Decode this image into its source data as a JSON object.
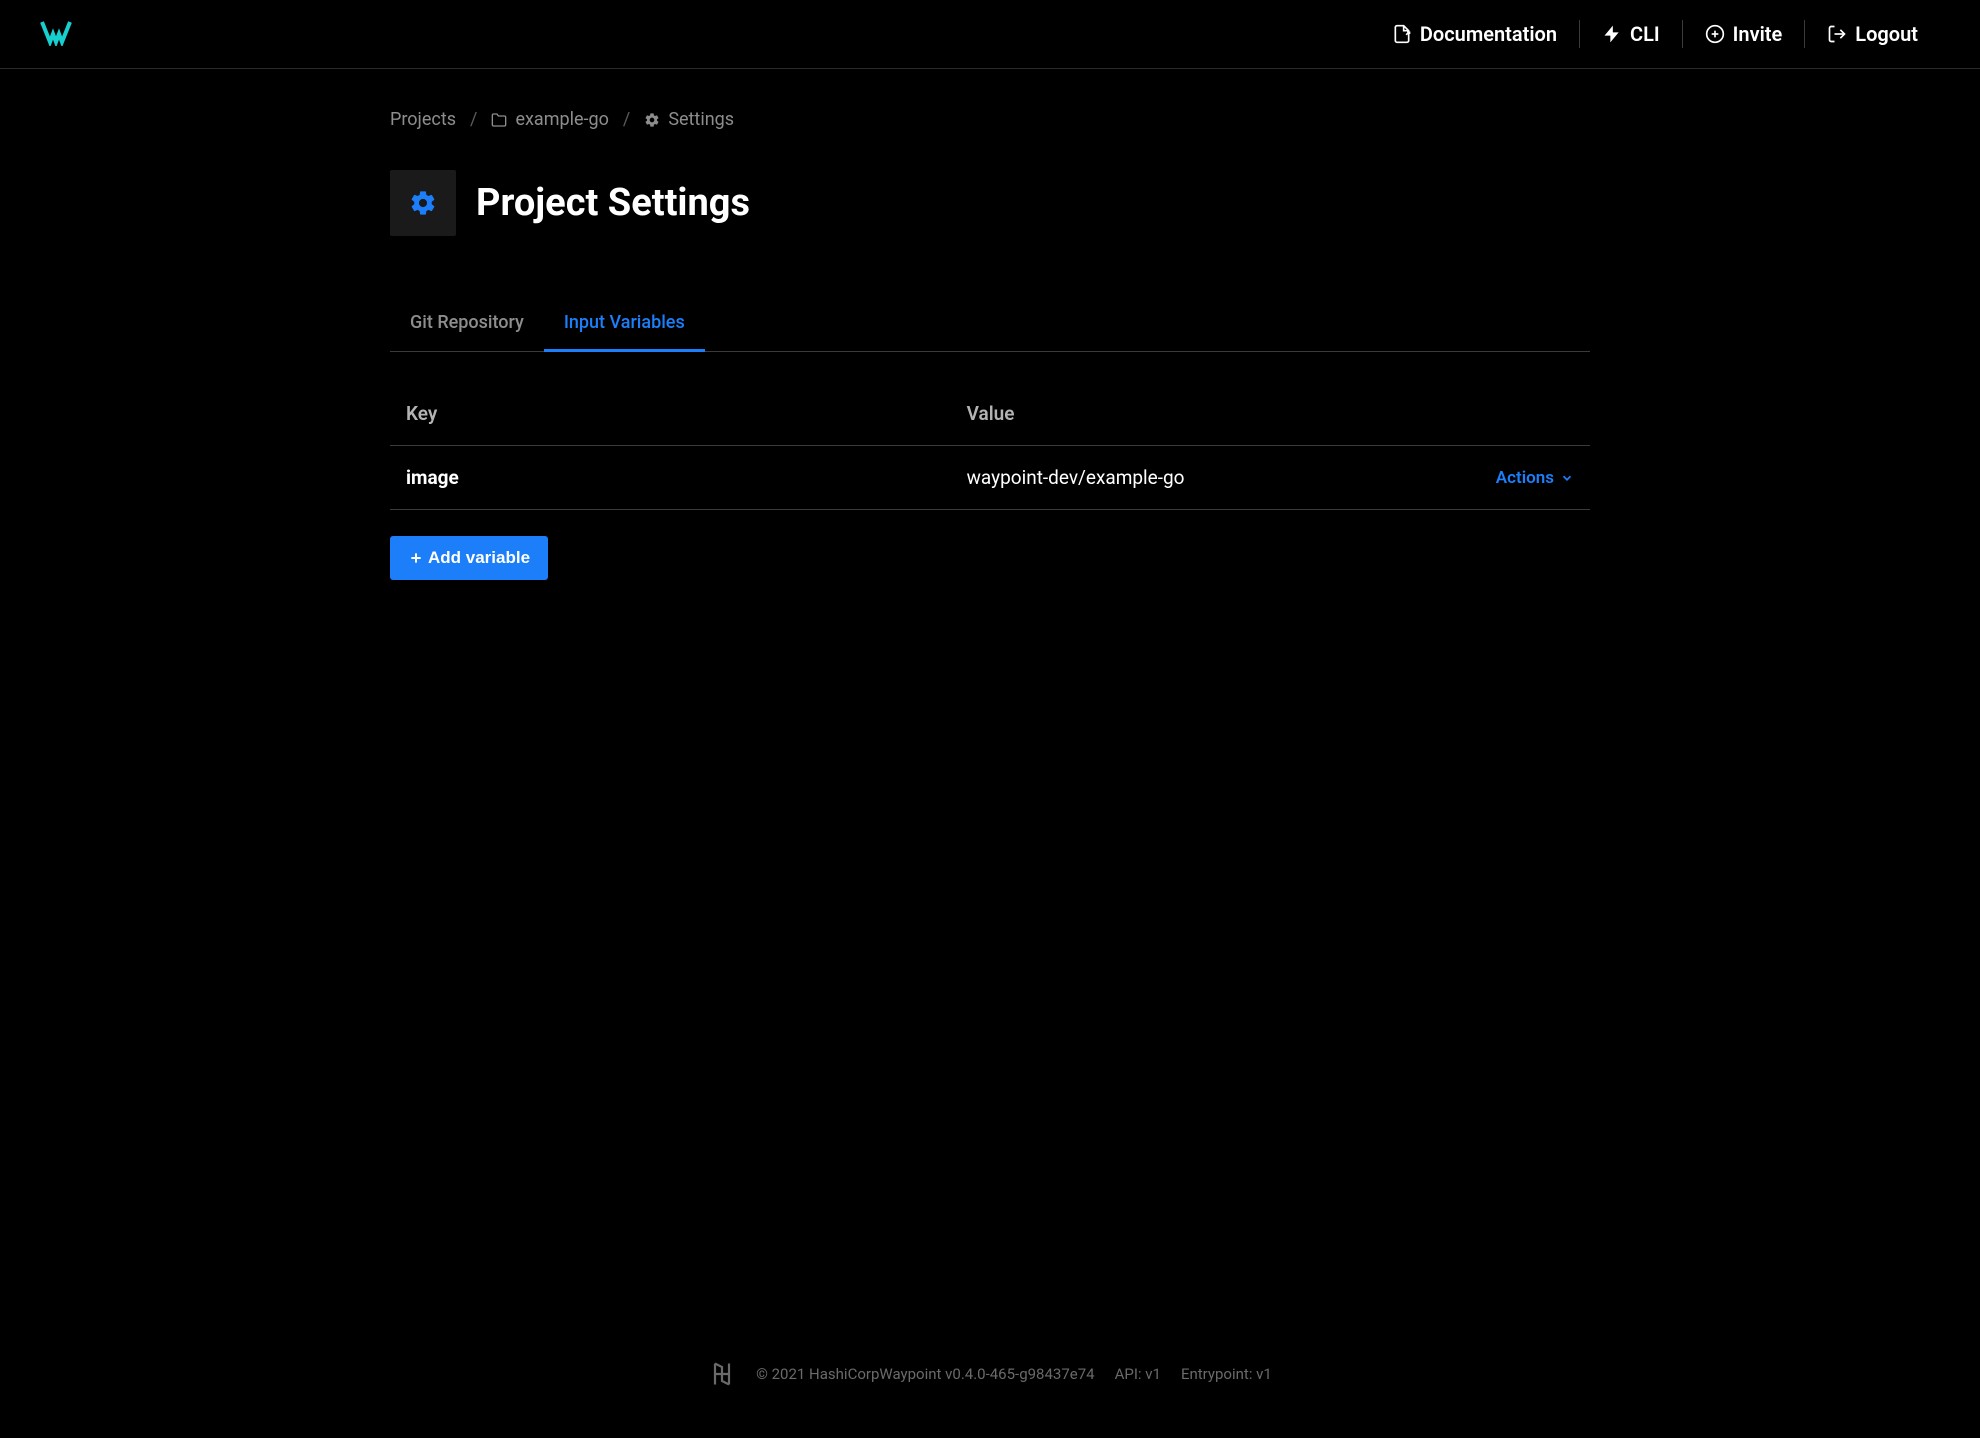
{
  "header": {
    "nav": {
      "documentation": "Documentation",
      "cli": "CLI",
      "invite": "Invite",
      "logout": "Logout"
    }
  },
  "breadcrumb": {
    "projects": "Projects",
    "project_name": "example-go",
    "settings": "Settings"
  },
  "page": {
    "title": "Project Settings"
  },
  "tabs": {
    "git_repository": "Git Repository",
    "input_variables": "Input Variables"
  },
  "table": {
    "headers": {
      "key": "Key",
      "value": "Value"
    },
    "rows": [
      {
        "key": "image",
        "value": "waypoint-dev/example-go"
      }
    ],
    "actions_label": "Actions"
  },
  "buttons": {
    "add_variable": "Add variable"
  },
  "footer": {
    "copyright": "© 2021 HashiCorp",
    "version": "Waypoint v0.4.0-465-g98437e74",
    "api": "API: v1",
    "entrypoint": "Entrypoint: v1"
  }
}
